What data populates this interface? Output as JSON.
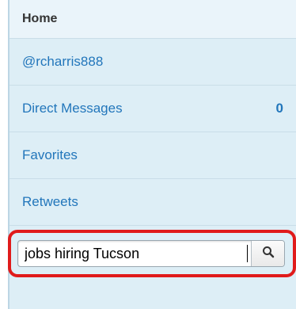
{
  "sidebar": {
    "items": [
      {
        "label": "Home",
        "count": ""
      },
      {
        "label": "@rcharris888",
        "count": ""
      },
      {
        "label": "Direct Messages",
        "count": "0"
      },
      {
        "label": "Favorites",
        "count": ""
      },
      {
        "label": "Retweets",
        "count": ""
      }
    ]
  },
  "search": {
    "value": "jobs hiring Tucson",
    "icon": "search-icon"
  },
  "colors": {
    "link": "#2276bb",
    "panel_bg": "#ddeef6",
    "highlight_border": "#e01b1b"
  }
}
